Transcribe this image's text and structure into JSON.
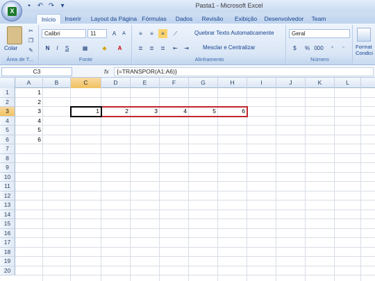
{
  "window": {
    "title": "Pasta1 - Microsoft Excel"
  },
  "tabs": [
    {
      "label": "Início",
      "active": true
    },
    {
      "label": "Inserir"
    },
    {
      "label": "Layout da Página"
    },
    {
      "label": "Fórmulas"
    },
    {
      "label": "Dados"
    },
    {
      "label": "Revisão"
    },
    {
      "label": "Exibição"
    },
    {
      "label": "Desenvolvedor"
    },
    {
      "label": "Team"
    }
  ],
  "ribbon": {
    "clipboard": {
      "paste_label": "Colar",
      "group_label": "Área de T..."
    },
    "font": {
      "font_name": "Calibri",
      "font_size": "11",
      "group_label": "Fonte",
      "bold": "N",
      "italic": "I",
      "underline": "S"
    },
    "alignment": {
      "wrap_text": "Quebrar Texto Automaticamente",
      "merge_center": "Mesclar e Centralizar",
      "group_label": "Alinhamento"
    },
    "number": {
      "format": "Geral",
      "percent": "%",
      "thousands": "000",
      "group_label": "Número"
    },
    "styles": {
      "label": "Format Condici"
    }
  },
  "formula_bar": {
    "name_box": "C3",
    "fx": "fx",
    "formula": "{=TRANSPOR(A1:A6)}"
  },
  "columns": [
    "A",
    "B",
    "C",
    "D",
    "E",
    "F",
    "G",
    "H",
    "I",
    "J",
    "K",
    "L"
  ],
  "rows": [
    "1",
    "2",
    "3",
    "4",
    "5",
    "6",
    "7",
    "8",
    "9",
    "10",
    "11",
    "12",
    "13",
    "14",
    "15",
    "16",
    "17",
    "18",
    "19",
    "20"
  ],
  "selected_column": "C",
  "selected_row": "3",
  "cells": {
    "A1": "1",
    "A2": "2",
    "A3": "3",
    "A4": "4",
    "A5": "5",
    "A6": "6",
    "C3": "1",
    "D3": "2",
    "E3": "3",
    "F3": "4",
    "G3": "5",
    "H3": "6"
  },
  "colors": {
    "selection_border": "#c0252c",
    "header_selected": "#f1c15f"
  }
}
